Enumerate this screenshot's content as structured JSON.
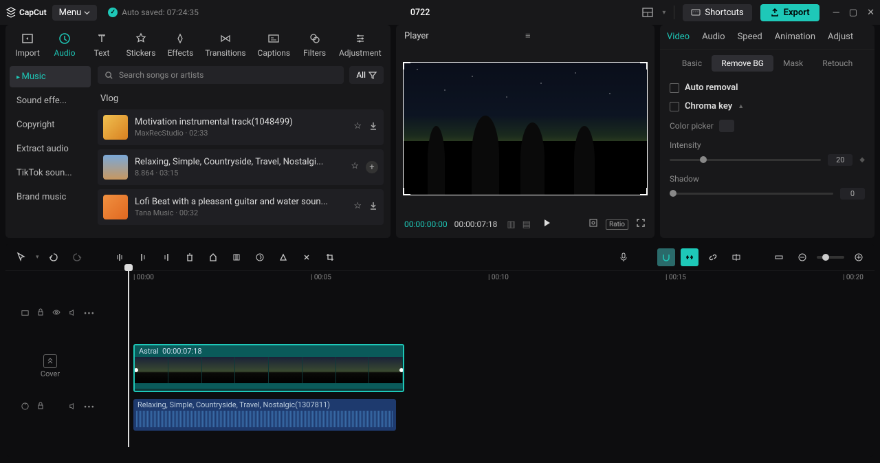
{
  "titlebar": {
    "app": "CapCut",
    "menu": "Menu",
    "auto_saved": "Auto saved: 07:24:35",
    "project": "0722",
    "shortcuts": "Shortcuts",
    "export": "Export"
  },
  "media_tabs": [
    "Import",
    "Audio",
    "Text",
    "Stickers",
    "Effects",
    "Transitions",
    "Captions",
    "Filters",
    "Adjustment"
  ],
  "media_tabs_active": 1,
  "sidebar": {
    "items": [
      "Music",
      "Sound effe...",
      "Copyright",
      "Extract audio",
      "TikTok soun...",
      "Brand music"
    ],
    "active": 0
  },
  "search": {
    "placeholder": "Search songs or artists",
    "all": "All"
  },
  "category": "Vlog",
  "tracks": [
    {
      "title": "Motivation instrumental track(1048499)",
      "meta": "MaxRecStudio · 02:33",
      "thumb": "#e6a53a"
    },
    {
      "title": "Relaxing, Simple, Countryside, Travel, Nostalgi...",
      "meta": "8.864 · 03:15",
      "thumb": "#5a8ac8"
    },
    {
      "title": "Lofi Beat with a pleasant guitar and water soun...",
      "meta": "Tana Music · 00:32",
      "thumb": "#e8893a"
    }
  ],
  "player": {
    "title": "Player",
    "current": "00:00:00:00",
    "duration": "00:00:07:18",
    "ratio": "Ratio"
  },
  "props": {
    "tabs": [
      "Video",
      "Audio",
      "Speed",
      "Animation",
      "Adjust"
    ],
    "tabs_active": 0,
    "subtabs": [
      "Basic",
      "Remove BG",
      "Mask",
      "Retouch"
    ],
    "subtabs_active": 1,
    "auto_removal": "Auto removal",
    "chroma_key": "Chroma key",
    "color_picker": "Color picker",
    "intensity": "Intensity",
    "intensity_val": "20",
    "shadow": "Shadow",
    "shadow_val": "0"
  },
  "ruler": [
    "00:00",
    "00:05",
    "00:10",
    "00:15",
    "00:20"
  ],
  "cover_label": "Cover",
  "clips": {
    "video": {
      "name": "Astral",
      "dur": "00:00:07:18"
    },
    "audio": {
      "name": "Relaxing, Simple, Countryside, Travel, Nostalgic(1307811)"
    }
  }
}
